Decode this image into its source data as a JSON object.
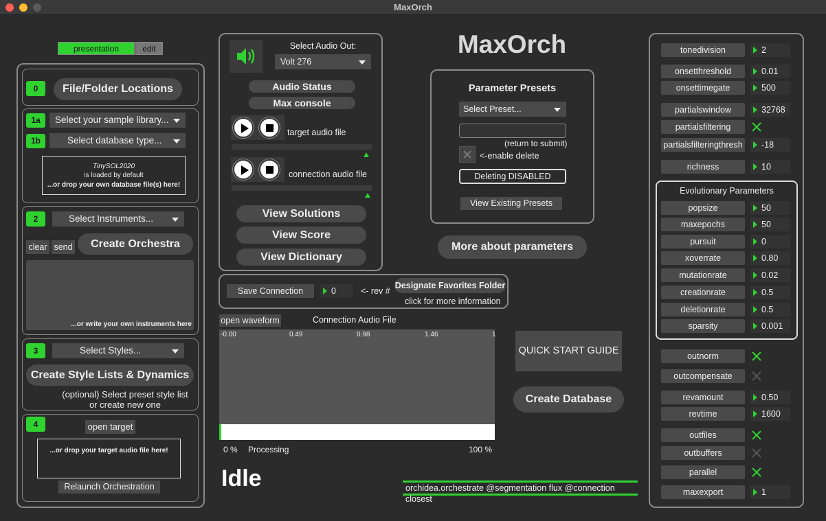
{
  "window": {
    "title": "MaxOrch"
  },
  "app_title": "MaxOrch",
  "mode_tabs": {
    "presentation": "presentation",
    "edit": "edit"
  },
  "steps": {
    "s0": {
      "num": "0",
      "button": "File/Folder Locations"
    },
    "s1a": {
      "num": "1a",
      "menu": "Select your sample library..."
    },
    "s1b": {
      "num": "1b",
      "menu": "Select database type..."
    },
    "db_drop": {
      "line1": "TinySOL2020",
      "line2": "is loaded by default",
      "line3": "...or drop your own database file(s) here!"
    },
    "s2": {
      "num": "2",
      "menu": "Select Instruments...",
      "clear": "clear",
      "send": "send",
      "create": "Create Orchestra",
      "hint": "...or write your own instruments here"
    },
    "s3": {
      "num": "3",
      "menu": "Select Styles...",
      "create": "Create Style Lists & Dynamics",
      "note1": "(optional) Select preset style list",
      "note2": "or create new one"
    },
    "s4": {
      "num": "4",
      "open": "open target",
      "drop": "...or drop your target audio file here!",
      "relaunch": "Relaunch Orchestration"
    }
  },
  "audio": {
    "out_label": "Select Audio Out:",
    "out_value": "Volt 276",
    "status_btn": "Audio Status",
    "console_btn": "Max console",
    "target_label": "target audio file",
    "connection_label": "connection audio file",
    "view_solutions": "View Solutions",
    "view_score": "View Score",
    "view_dictionary": "View Dictionary"
  },
  "connection": {
    "save": "Save Connection",
    "rev_value": "0",
    "rev_label": "<- rev #",
    "favorites": "Designate Favorites Folder",
    "info": "click for more information"
  },
  "waveform": {
    "open": "open waveform",
    "title": "Connection Audio File",
    "ticks": [
      "-0.00",
      "0.49",
      "0.98",
      "1.46",
      "1"
    ],
    "progress_fraction": 0.0,
    "pct_left": "0 %",
    "processing": "Processing",
    "pct_right": "100 %"
  },
  "status": "Idle",
  "presets": {
    "title": "Parameter Presets",
    "select": "Select Preset...",
    "input_value": "",
    "return_hint": "(return to submit)",
    "enable_delete": "<-enable delete",
    "deleting": "Deleting DISABLED",
    "view_existing": "View Existing Presets"
  },
  "more_params": "More about parameters",
  "quick_start": "QUICK START GUIDE",
  "create_db": "Create Database",
  "command": "orchidea.orchestrate @segmentation flux @connection closest",
  "params_top": [
    {
      "name": "tonedivision",
      "value": "2"
    },
    {
      "name": "onsetthreshold",
      "value": "0.01"
    },
    {
      "name": "onsettimegate",
      "value": "500"
    },
    {
      "name": "partialswindow",
      "value": "32768"
    },
    {
      "name": "partialsfiltering",
      "toggle": true
    },
    {
      "name": "partialsfilteringthresh",
      "value": "-18"
    },
    {
      "name": "richness",
      "value": "10"
    }
  ],
  "evo": {
    "title": "Evolutionary Parameters",
    "items": [
      {
        "name": "popsize",
        "value": "50"
      },
      {
        "name": "maxepochs",
        "value": "50"
      },
      {
        "name": "pursuit",
        "value": "0"
      },
      {
        "name": "xoverrate",
        "value": "0.80"
      },
      {
        "name": "mutationrate",
        "value": "0.02"
      },
      {
        "name": "creationrate",
        "value": "0.5"
      },
      {
        "name": "deletionrate",
        "value": "0.5"
      },
      {
        "name": "sparsity",
        "value": "0.001"
      }
    ]
  },
  "params_bottom": [
    {
      "name": "outnorm",
      "toggle": true
    },
    {
      "name": "outcompensate",
      "toggle": false
    },
    {
      "name": "revamount",
      "value": "0.50"
    },
    {
      "name": "revtime",
      "value": "1600"
    },
    {
      "name": "outfiles",
      "toggle": true
    },
    {
      "name": "outbuffers",
      "toggle": false
    },
    {
      "name": "parallel",
      "toggle": true
    },
    {
      "name": "maxexport",
      "value": "1"
    }
  ],
  "colors": {
    "accent": "#30d230",
    "bg": "#2b2b2b",
    "button": "#4a4a4a"
  }
}
